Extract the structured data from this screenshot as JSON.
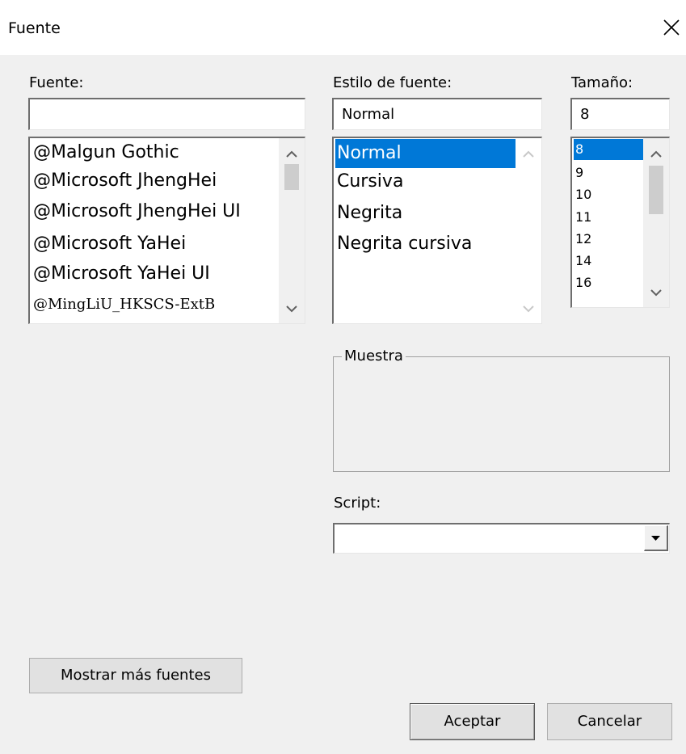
{
  "window": {
    "title": "Fuente"
  },
  "font": {
    "label": "Fuente:",
    "input_value": "",
    "items": [
      "@Malgun Gothic",
      "@Microsoft JhengHei",
      "@Microsoft JhengHei UI",
      "@Microsoft YaHei",
      "@Microsoft YaHei UI",
      "@MingLiU_HKSCS-ExtB"
    ]
  },
  "style": {
    "label": "Estilo de fuente:",
    "input_value": "Normal",
    "items": [
      "Normal",
      "Cursiva",
      "Negrita",
      "Negrita cursiva"
    ],
    "selected": "Normal"
  },
  "size": {
    "label": "Tamaño:",
    "input_value": "8",
    "items": [
      "8",
      "9",
      "10",
      "11",
      "12",
      "14",
      "16"
    ],
    "selected": "8"
  },
  "sample": {
    "label": "Muestra"
  },
  "script": {
    "label": "Script:",
    "value": ""
  },
  "buttons": {
    "more_fonts": "Mostrar más fuentes",
    "ok": "Aceptar",
    "cancel": "Cancelar"
  },
  "colors": {
    "selection": "#0078d7",
    "background": "#f0f0f0"
  },
  "icons": {
    "close": "close-icon",
    "scroll_up": "chevron-up-icon",
    "scroll_down": "chevron-down-icon",
    "dropdown": "triangle-down-icon"
  }
}
